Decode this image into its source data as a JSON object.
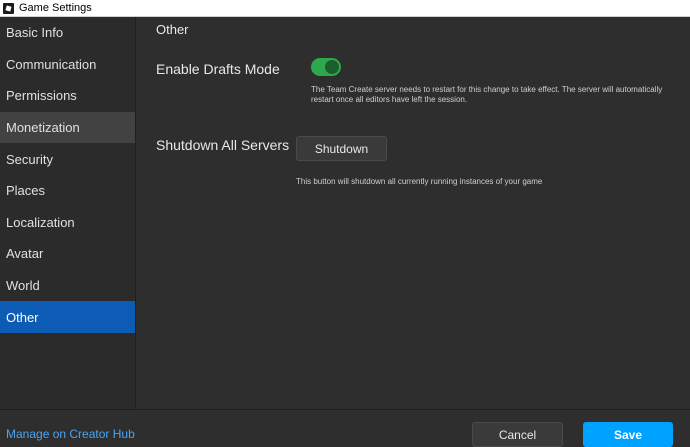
{
  "window": {
    "title": "Game Settings",
    "icon": "roblox-studio-icon"
  },
  "sidebar": {
    "items": [
      {
        "label": "Basic Info",
        "state": "normal"
      },
      {
        "label": "Communication",
        "state": "normal"
      },
      {
        "label": "Permissions",
        "state": "normal"
      },
      {
        "label": "Monetization",
        "state": "hover"
      },
      {
        "label": "Security",
        "state": "normal"
      },
      {
        "label": "Places",
        "state": "normal"
      },
      {
        "label": "Localization",
        "state": "normal"
      },
      {
        "label": "Avatar",
        "state": "normal"
      },
      {
        "label": "World",
        "state": "normal"
      },
      {
        "label": "Other",
        "state": "active"
      }
    ]
  },
  "main": {
    "section_title": "Other",
    "drafts": {
      "label": "Enable Drafts Mode",
      "enabled": true,
      "toggle_color": "#2da84d",
      "description": "The Team Create server needs to restart for this change to take effect. The server will automatically restart once all editors have left the session."
    },
    "shutdown": {
      "label": "Shutdown All Servers",
      "button_label": "Shutdown",
      "description": "This button will shutdown all currently running instances of your game"
    }
  },
  "footer": {
    "link_label": "Manage on Creator Hub",
    "cancel_label": "Cancel",
    "save_label": "Save",
    "save_color": "#00a2ff",
    "link_color": "#4ba3f0"
  }
}
